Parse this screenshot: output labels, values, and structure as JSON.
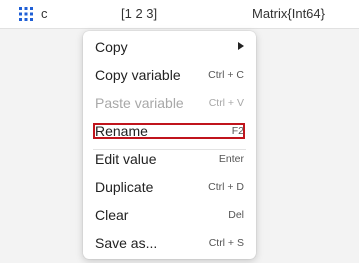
{
  "variable_row": {
    "icon": "grid-icon",
    "name": "c",
    "value": "[1 2 3]",
    "type": "Matrix{Int64}"
  },
  "context_menu": {
    "items": [
      {
        "label": "Copy",
        "shortcut": "",
        "has_submenu": true,
        "disabled": false
      },
      {
        "label": "Copy variable",
        "shortcut": "Ctrl + C",
        "has_submenu": false,
        "disabled": false
      },
      {
        "label": "Paste variable",
        "shortcut": "Ctrl + V",
        "has_submenu": false,
        "disabled": true
      },
      {
        "label": "Rename",
        "shortcut": "F2",
        "has_submenu": false,
        "disabled": false,
        "highlighted": true
      },
      {
        "label": "Edit value",
        "shortcut": "Enter",
        "has_submenu": false,
        "disabled": false
      },
      {
        "label": "Duplicate",
        "shortcut": "Ctrl + D",
        "has_submenu": false,
        "disabled": false
      },
      {
        "label": "Clear",
        "shortcut": "Del",
        "has_submenu": false,
        "disabled": false
      },
      {
        "label": "Save as...",
        "shortcut": "Ctrl + S",
        "has_submenu": false,
        "disabled": false
      }
    ]
  },
  "colors": {
    "icon_blue": "#1f5fd6",
    "highlight_red": "#c0141c",
    "disabled_text": "#a8a8a8"
  }
}
